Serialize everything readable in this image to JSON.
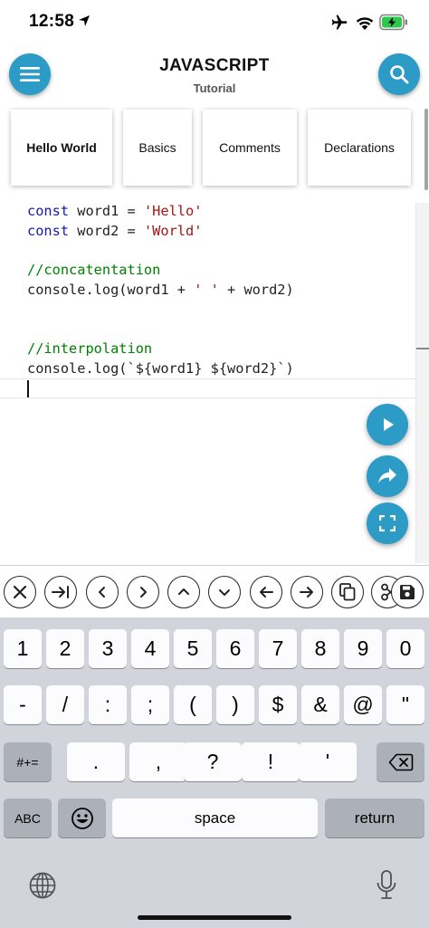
{
  "status_bar": {
    "time": "12:58"
  },
  "header": {
    "title": "JAVASCRIPT",
    "subtitle": "Tutorial"
  },
  "tabs": [
    {
      "label": "Hello World",
      "active": true
    },
    {
      "label": "Basics"
    },
    {
      "label": "Comments"
    },
    {
      "label": "Declarations"
    }
  ],
  "code": {
    "line1": {
      "keyword": "const",
      "text": " word1 = ",
      "string": "'Hello'"
    },
    "line2": {
      "keyword": "const",
      "text": " word2 = ",
      "string": "'World'"
    },
    "line4": {
      "comment": "//concatentation"
    },
    "line5": {
      "before": "console.log(word1 + ",
      "string": "' '",
      "after": " + word2)"
    },
    "line8": {
      "comment": "//interpolation"
    },
    "line9": {
      "text": "console.log(`${word1} ${word2}`)"
    }
  },
  "fabs": {
    "run": "play-icon",
    "share": "share-icon",
    "fullscreen": "fullscreen-icon"
  },
  "toolbar_icons": [
    "close-icon",
    "tab-icon",
    "chevron-left-icon",
    "chevron-right-icon",
    "chevron-up-icon",
    "chevron-down-icon",
    "arrow-left-icon",
    "arrow-right-icon",
    "copy-icon",
    "cut-icon",
    "save-icon"
  ],
  "keyboard": {
    "row1": [
      "1",
      "2",
      "3",
      "4",
      "5",
      "6",
      "7",
      "8",
      "9",
      "0"
    ],
    "row2": [
      "-",
      "/",
      ":",
      ";",
      "(",
      ")",
      "$",
      "&",
      "@",
      "\""
    ],
    "row3": [
      ".",
      ",",
      "?",
      "!",
      "'"
    ],
    "symbols_key": "#+=",
    "abc_key": "ABC",
    "space_key": "space",
    "return_key": "return"
  },
  "colors": {
    "accent": "#2c9bc5",
    "keyword": "#1a1aa6",
    "string": "#a31515",
    "comment": "#008000"
  }
}
